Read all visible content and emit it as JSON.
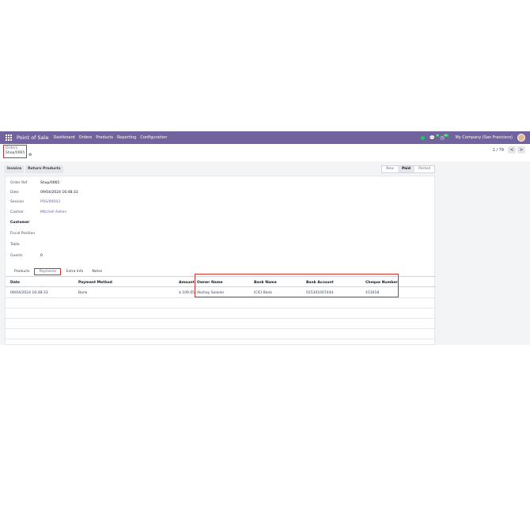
{
  "navbar": {
    "brand": "Point of Sale",
    "menu": [
      "Dashboard",
      "Orders",
      "Products",
      "Reporting",
      "Configuration"
    ],
    "chat_badge": "9",
    "activity_badge": "24",
    "company": "My Company (San Francisco)"
  },
  "breadcrumb": {
    "parent": "Orders",
    "current": "Shop/0065"
  },
  "pager": {
    "value": "1 / 79",
    "prev": "<",
    "next": ">"
  },
  "actions": {
    "invoice": "Invoice",
    "return_products": "Return Products"
  },
  "status": {
    "stages": [
      "New",
      "Paid",
      "Posted"
    ],
    "active": "Paid"
  },
  "form": {
    "order_ref_label": "Order Ref",
    "order_ref": "Shop/0065",
    "date_label": "Date",
    "date": "09/04/2024 16:48:33",
    "session_label": "Session",
    "session": "POS/00043",
    "cashier_label": "Cashier",
    "cashier": "Mitchell Admin",
    "customer_title": "Customer",
    "fiscal_position_label": "Fiscal Position",
    "table_label": "Table",
    "guests_label": "Guests",
    "guests": "0"
  },
  "tabs": [
    "Products",
    "Payments",
    "Extra Info",
    "Notes"
  ],
  "payments": {
    "headers": [
      "Date",
      "Payment Method",
      "Amount",
      "Owner Name",
      "Bank Name",
      "Bank Account",
      "Cheque Number"
    ],
    "rows": [
      [
        "09/04/2024 16:48:33",
        "Bank",
        "$ 109.05",
        "Akshay Solanki",
        "ICICI Bank",
        "015301007444",
        "413018"
      ]
    ]
  }
}
